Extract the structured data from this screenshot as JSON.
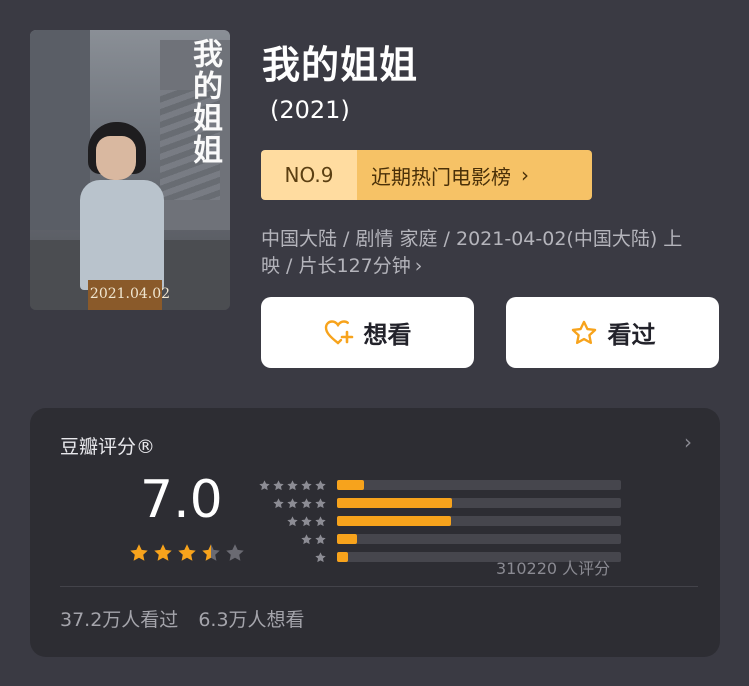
{
  "movie": {
    "title": "我的姐姐",
    "year": "(2021)",
    "poster": {
      "title_art": "我的姐姐",
      "date": "2021.04.02"
    },
    "ranking": {
      "number": "NO.9",
      "list_name": "近期热门电影榜",
      "chevron": "›"
    },
    "info_text": "中国大陆 / 剧情 家庭 / 2021-04-02(中国大陆) 上映 / 片长127分钟",
    "info_more": "›"
  },
  "actions": {
    "want_label": "想看",
    "seen_label": "看过"
  },
  "rating": {
    "label": "豆瓣评分®",
    "arrow": "›",
    "score": "7.0",
    "stars": 3.5,
    "distribution": [
      {
        "stars": 5,
        "percent": 9.5
      },
      {
        "stars": 4,
        "percent": 40.5
      },
      {
        "stars": 3,
        "percent": 40.0
      },
      {
        "stars": 2,
        "percent": 7.0
      },
      {
        "stars": 1,
        "percent": 4.0
      }
    ],
    "count_text": "310220 人评分",
    "watched_text": "37.2万人看过",
    "wish_text": "6.3万人想看"
  },
  "colors": {
    "background": "#3a3a43",
    "card": "#2d2d33",
    "accent": "#f7a31c",
    "rank_light": "#ffdca0",
    "rank_dark": "#f6c266"
  }
}
